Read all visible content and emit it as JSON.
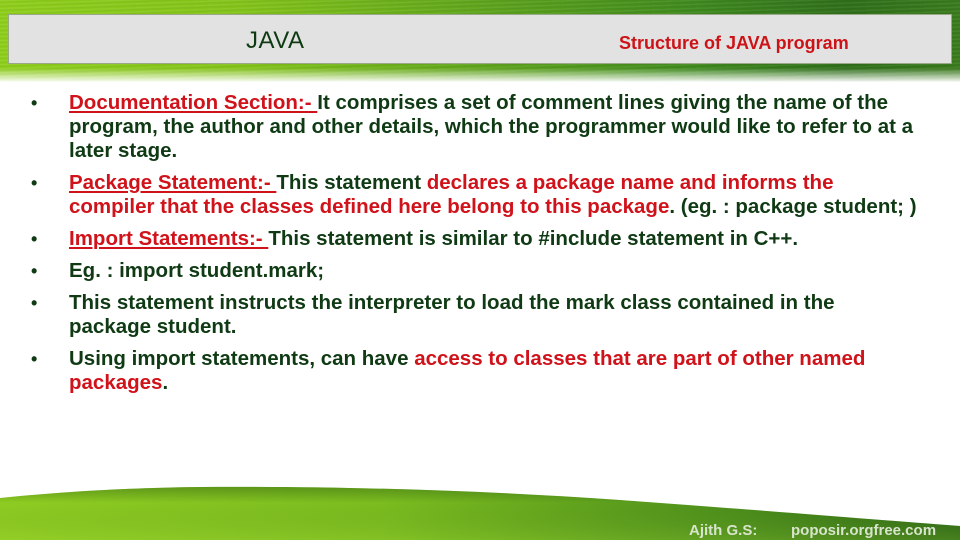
{
  "header": {
    "title": "JAVA",
    "subtitle": "Structure of JAVA program"
  },
  "colors": {
    "body_text": "#0f3a14",
    "highlight": "#d0121a",
    "header_band": "#e2e2e2",
    "grass": "#6fb51c"
  },
  "bullets": [
    {
      "segments": [
        {
          "text": "Documentation Section:- ",
          "style": "hl-u"
        },
        {
          "text": "It comprises a set of comment lines giving the name of the program, the author and other details, which the programmer would like to refer to at a later stage.",
          "style": "normal"
        }
      ]
    },
    {
      "segments": [
        {
          "text": "Package Statement:- ",
          "style": "hl-u"
        },
        {
          "text": "This statement ",
          "style": "normal"
        },
        {
          "text": "declares a package name and informs the compiler that the classes defined here belong to this package",
          "style": "hl"
        },
        {
          "text": ". (eg. : package student; )",
          "style": "normal"
        }
      ]
    },
    {
      "segments": [
        {
          "text": "Import Statements:- ",
          "style": "hl-u"
        },
        {
          "text": "This statement is similar to #include statement in C++.",
          "style": "normal"
        }
      ]
    },
    {
      "segments": [
        {
          "text": "Eg. : import student.mark;",
          "style": "normal"
        }
      ]
    },
    {
      "segments": [
        {
          "text": "This statement instructs the interpreter to load the mark class contained in the package student.",
          "style": "normal"
        }
      ]
    },
    {
      "segments": [
        {
          "text": "Using import statements,  can have ",
          "style": "normal"
        },
        {
          "text": "access to classes that are part of other named packages",
          "style": "hl"
        },
        {
          "text": ".",
          "style": "normal"
        }
      ]
    }
  ],
  "bullet_glyph": "•",
  "footer": {
    "author": "Ajith G.S:",
    "site": "poposir.orgfree.com"
  }
}
